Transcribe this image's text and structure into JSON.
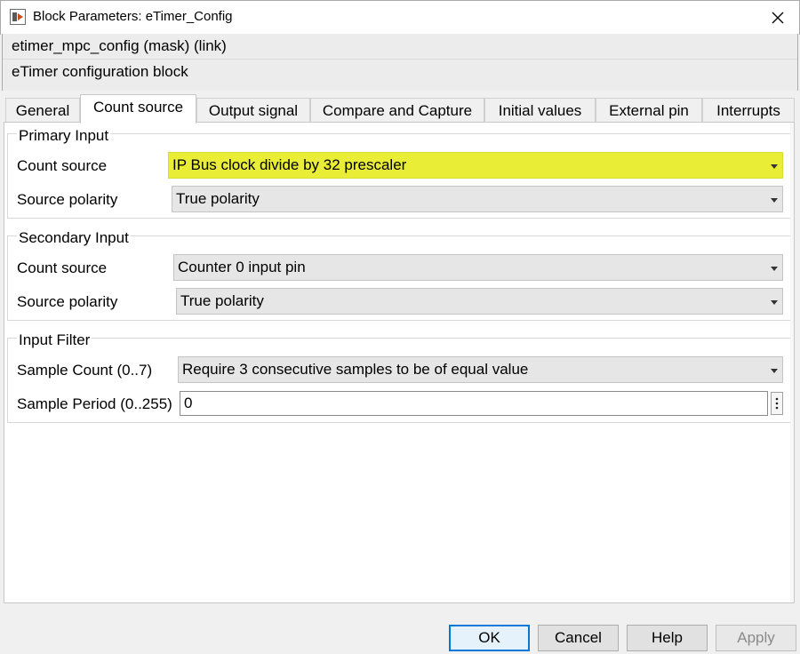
{
  "window": {
    "title": "Block Parameters: eTimer_Config"
  },
  "header": {
    "mask_line": "etimer_mpc_config (mask) (link)",
    "description": "eTimer configuration block"
  },
  "tabs": [
    {
      "label": "General"
    },
    {
      "label": "Count source",
      "active": true
    },
    {
      "label": "Output signal"
    },
    {
      "label": "Compare and Capture"
    },
    {
      "label": "Initial values"
    },
    {
      "label": "External pin"
    },
    {
      "label": "Interrupts"
    }
  ],
  "primary_input": {
    "title": "Primary Input",
    "count_source_label": "Count source",
    "count_source_value": "IP Bus clock divide by 32 prescaler",
    "source_polarity_label": "Source polarity",
    "source_polarity_value": "True polarity"
  },
  "secondary_input": {
    "title": "Secondary Input",
    "count_source_label": "Count source",
    "count_source_value": "Counter 0 input pin",
    "source_polarity_label": "Source polarity",
    "source_polarity_value": "True polarity"
  },
  "input_filter": {
    "title": "Input Filter",
    "sample_count_label": "Sample Count (0..7)",
    "sample_count_value": "Require 3 consecutive samples to be of equal value",
    "sample_period_label": "Sample Period (0..255)",
    "sample_period_value": "0"
  },
  "buttons": {
    "ok": "OK",
    "cancel": "Cancel",
    "help": "Help",
    "apply": "Apply"
  },
  "colors": {
    "highlight": "#e9ed35",
    "focus_border": "#0078d7"
  },
  "icons": {
    "app": "simulink-block-icon",
    "close": "close-icon",
    "dropdown": "chevron-down-icon",
    "more": "vertical-ellipsis-icon"
  }
}
